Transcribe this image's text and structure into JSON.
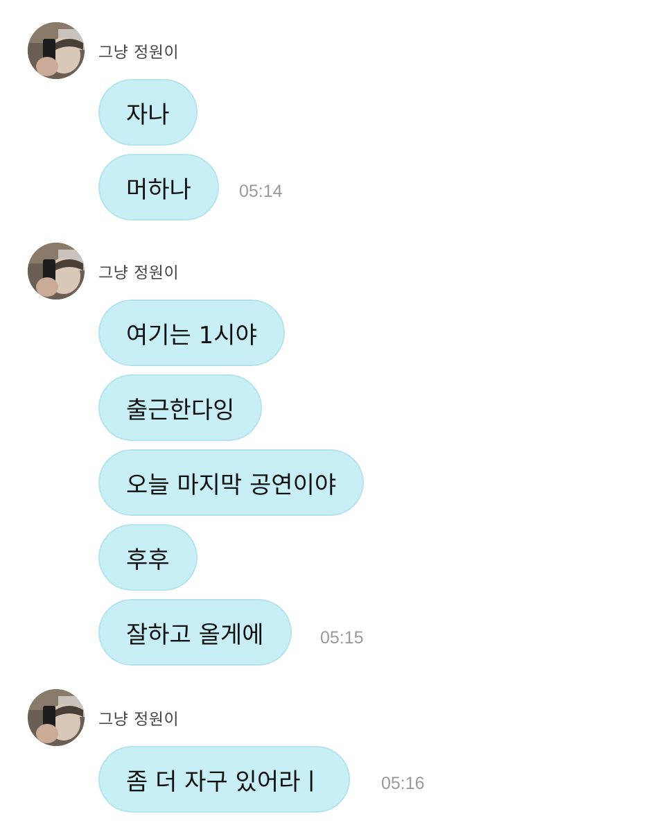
{
  "groups": [
    {
      "sender": "그냥 정원이",
      "messages": [
        "자나",
        "머하나"
      ],
      "time": "05:14"
    },
    {
      "sender": "그냥 정원이",
      "messages": [
        "여기는 1시야",
        "출근한다잉",
        "오늘 마지막 공연이야",
        "후후",
        "잘하고 올게에"
      ],
      "time": "05:15"
    },
    {
      "sender": "그냥 정원이",
      "messages": [
        "좀 더 자구 있어라ㅣ"
      ],
      "time": "05:16"
    }
  ],
  "icons": {
    "avatar": "profile-photo-avatar"
  }
}
